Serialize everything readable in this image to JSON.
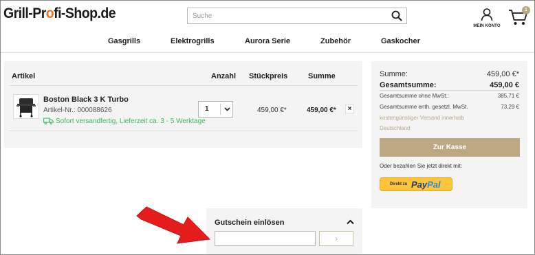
{
  "header": {
    "logo_part1": "Grill-Pr",
    "logo_flame": "o",
    "logo_part2": "fi-Shop.de",
    "search_placeholder": "Suche",
    "search_icon": "magnifier-icon",
    "account_label": "MEIN KONTO",
    "account_icon": "user-icon",
    "cart_icon": "cart-icon",
    "cart_count": "1"
  },
  "nav": {
    "items": [
      "Gasgrills",
      "Elektrogrills",
      "Aurora Serie",
      "Zubehör",
      "Gaskocher"
    ]
  },
  "cart": {
    "headers": {
      "article": "Artikel",
      "quantity": "Anzahl",
      "unit_price": "Stückpreis",
      "total": "Summe"
    },
    "items": [
      {
        "name": "Boston Black 3 K Turbo",
        "article_no": "Artikel-Nr.: 000088626",
        "shipping": "Sofort versandfertig, Lieferzeit ca. 3 - 5 Werktage",
        "quantity": "1",
        "unit_price": "459,00 €*",
        "total": "459,00 €*",
        "remove": "×"
      }
    ]
  },
  "summary": {
    "sum_label": "Summe:",
    "sum_value": "459,00 €*",
    "total_label": "Gesamtsumme:",
    "total_value": "459,00 €",
    "net_label": "Gesamtsumme ohne MwSt.:",
    "net_value": "385,71 €",
    "vat_label": "Gesamtsumme enth. gesetzl. MwSt.",
    "vat_value": "73,29 €",
    "shipping_note_1": "kostengünstiger Versand innerhalb",
    "shipping_note_2": "Deutschland",
    "checkout_label": "Zur Kasse",
    "pay_direct_text": "Oder bezahlen Sie jetzt direkt mit:",
    "paypal_prefix": "Direkt zu",
    "paypal_brand_1": "Pay",
    "paypal_brand_2": "Pal"
  },
  "voucher": {
    "title": "Gutschein einlösen",
    "input_value": "",
    "submit_label": "›"
  },
  "colors": {
    "accent": "#bca984",
    "success": "#3cb95c",
    "panel_bg": "#f4f4f4",
    "annotation_arrow": "#e51c1c",
    "paypal_yellow": "#ffc439"
  }
}
